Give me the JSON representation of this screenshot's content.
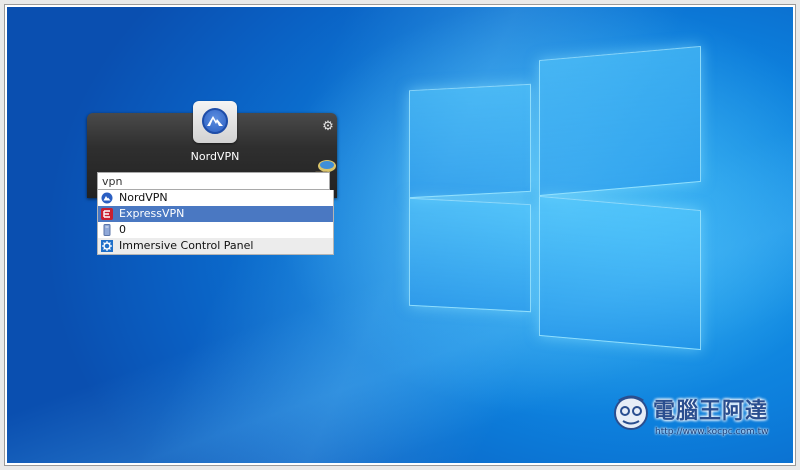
{
  "launcher": {
    "app_name": "NordVPN",
    "query": "vpn",
    "results": [
      {
        "label": "NordVPN",
        "icon": "nordvpn-icon",
        "selected": false
      },
      {
        "label": "ExpressVPN",
        "icon": "expressvpn-icon",
        "selected": true
      },
      {
        "label": "0",
        "icon": "file-icon",
        "selected": false
      },
      {
        "label": "Immersive Control Panel",
        "icon": "settings-icon",
        "selected": false
      }
    ]
  },
  "watermark": {
    "title": "電腦王阿達",
    "url": "http://www.kocpc.com.tw"
  },
  "colors": {
    "desktop_blue": "#0d7fdc",
    "selection": "#4a78c2",
    "launcher_dark": "#2f2f2f"
  }
}
